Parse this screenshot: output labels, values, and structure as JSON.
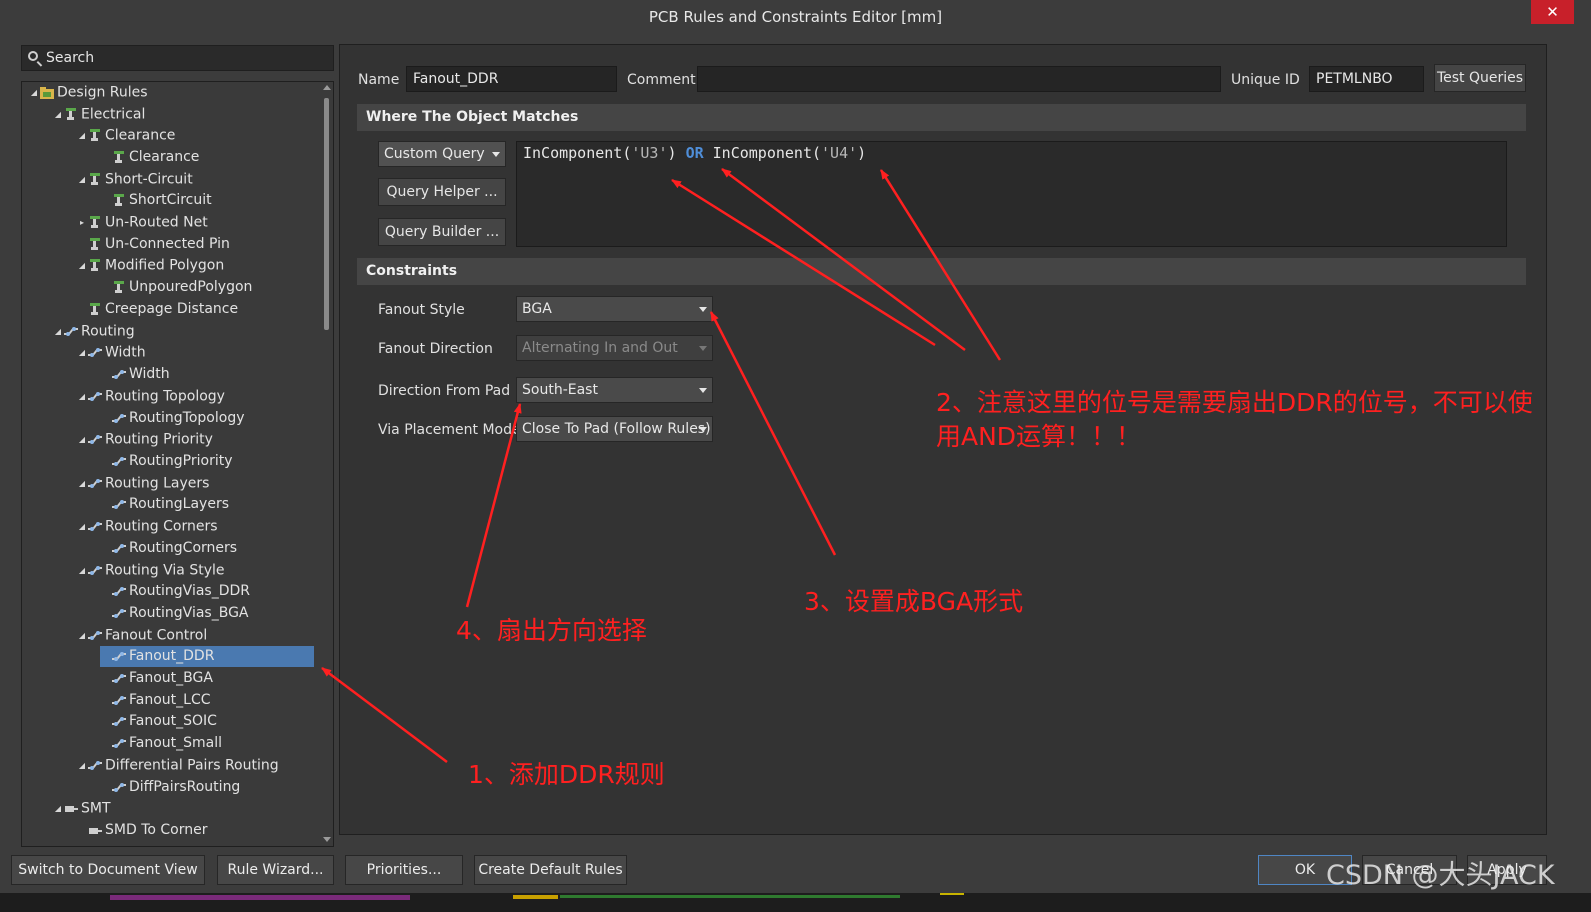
{
  "window": {
    "title": "PCB Rules and Constraints Editor [mm]",
    "close_glyph": "✕"
  },
  "search": {
    "placeholder": "Search"
  },
  "tree": {
    "design_rules": "Design Rules",
    "electrical": "Electrical",
    "clearance": "Clearance",
    "clearance_rule": "Clearance",
    "short_circuit": "Short-Circuit",
    "short_circuit_rule": "ShortCircuit",
    "unrouted_net": "Un-Routed Net",
    "unconnected_pin": "Un-Connected Pin",
    "modified_polygon": "Modified Polygon",
    "unpoured_polygon": "UnpouredPolygon",
    "creepage_distance": "Creepage Distance",
    "routing": "Routing",
    "width": "Width",
    "width_rule": "Width",
    "routing_topology": "Routing Topology",
    "routing_topology_rule": "RoutingTopology",
    "routing_priority": "Routing Priority",
    "routing_priority_rule": "RoutingPriority",
    "routing_layers": "Routing Layers",
    "routing_layers_rule": "RoutingLayers",
    "routing_corners": "Routing Corners",
    "routing_corners_rule": "RoutingCorners",
    "routing_via_style": "Routing Via Style",
    "routing_vias_ddr": "RoutingVias_DDR",
    "routing_vias_bga": "RoutingVias_BGA",
    "fanout_control": "Fanout Control",
    "fanout_ddr": "Fanout_DDR",
    "fanout_bga": "Fanout_BGA",
    "fanout_lcc": "Fanout_LCC",
    "fanout_soic": "Fanout_SOIC",
    "fanout_small": "Fanout_Small",
    "diff_pairs_routing": "Differential Pairs Routing",
    "diff_pairs_routing_rule": "DiffPairsRouting",
    "smt": "SMT",
    "smd_to_corner": "SMD To Corner"
  },
  "header": {
    "name_label": "Name",
    "name_value": "Fanout_DDR",
    "comment_label": "Comment",
    "comment_value": "",
    "unique_id_label": "Unique ID",
    "unique_id_value": "PETMLNBO",
    "test_queries": "Test Queries"
  },
  "where": {
    "title": "Where The Object Matches",
    "query_type": "Custom Query",
    "query_helper": "Query Helper ...",
    "query_builder": "Query Builder ...",
    "query_parts": [
      "InComponent(",
      "'U3'",
      ") ",
      "OR",
      " InComponent(",
      "'U4'",
      ")"
    ]
  },
  "constraints": {
    "title": "Constraints",
    "fanout_style_label": "Fanout Style",
    "fanout_style_value": "BGA",
    "fanout_direction_label": "Fanout Direction",
    "fanout_direction_value": "Alternating In and Out",
    "direction_from_pad_label": "Direction From Pad",
    "direction_from_pad_value": "South-East",
    "via_placement_label": "Via Placement Mode",
    "via_placement_value": "Close To Pad (Follow Rules)"
  },
  "footer": {
    "switch_view": "Switch to Document View",
    "rule_wizard": "Rule Wizard...",
    "priorities": "Priorities...",
    "create_default": "Create Default Rules",
    "ok": "OK",
    "cancel": "Cancel",
    "apply": "Apply"
  },
  "annotations": {
    "a1": "1、添加DDR规则",
    "a2": "2、注意这里的位号是需要扇出DDR的位号，不可以使用AND运算！！！",
    "a3": "3、设置成BGA形式",
    "a4": "4、扇出方向选择"
  },
  "watermark": "CSDN @大头JACK",
  "colors": {
    "annotation": "#ff2020",
    "selection": "#4a79b0",
    "keyword": "#4f8ed8"
  }
}
